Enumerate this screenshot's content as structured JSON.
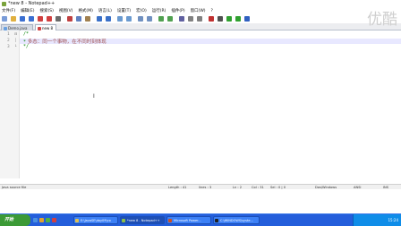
{
  "window": {
    "title": "*new  8 - Notepad++"
  },
  "menu": [
    "文件(F)",
    "编辑(E)",
    "搜索(S)",
    "视图(V)",
    "格式(M)",
    "语言(L)",
    "设置(T)",
    "宏(O)",
    "运行(R)",
    "插件(P)",
    "窗口(W)",
    "?"
  ],
  "toolbar": {
    "icons": [
      "new-file-icon",
      "open-file-icon",
      "save-icon",
      "save-all-icon",
      "close-icon",
      "close-all-icon",
      "print-icon",
      "cut-icon",
      "copy-icon",
      "paste-icon",
      "undo-icon",
      "redo-icon",
      "find-icon",
      "replace-icon",
      "zoom-in-icon",
      "zoom-out-icon",
      "sync-vertical-icon",
      "sync-horizontal-icon",
      "word-wrap-icon",
      "show-all-chars-icon",
      "indent-guide-icon",
      "macro-record-icon",
      "macro-stop-icon",
      "macro-play-icon",
      "macro-run-multiple-icon",
      "macro-save-icon"
    ],
    "colors": [
      "#7a9cd8",
      "#e0b040",
      "#3b6fd1",
      "#3b6fd1",
      "#d04040",
      "#d04040",
      "#6a6a6a",
      "#c04040",
      "#6080c0",
      "#a08050",
      "#3a70c8",
      "#3a70c8",
      "#6a9ad0",
      "#6a9ad0",
      "#7090c0",
      "#7090c0",
      "#50a050",
      "#50a050",
      "#6060a0",
      "#808080",
      "#808080",
      "#c03030",
      "#505050",
      "#30a030",
      "#30a030",
      "#3060c0"
    ]
  },
  "tabs": [
    {
      "label": "Demo.java",
      "active": false,
      "icon_color": "#6aa0e0"
    },
    {
      "label": "new 8",
      "active": true,
      "icon_color": "#d04040"
    }
  ],
  "editor": {
    "line_numbers": [
      "1",
      "2",
      "3"
    ],
    "lines": [
      {
        "code": "/*"
      },
      {
        "code": "*",
        "text": " 多态：同一个事物，在不同时刻体现"
      },
      {
        "code": "*/"
      }
    ],
    "cursor": "I",
    "watermark": "优酷"
  },
  "status": {
    "file_type": "Java source file",
    "length": "Length : 41",
    "lines": "lines : 3",
    "ln": "Ln : 2",
    "col": "Col : 31",
    "sel": "Sel : 0 | 0",
    "eol": "Dos\\Windows",
    "encoding": "ANSI",
    "mode": "INS"
  },
  "taskbar": {
    "start_label": "开始",
    "buttons": [
      {
        "label": "E:\\JavaSE\\day09\\co",
        "icon_color": "#e0c050"
      },
      {
        "label": "*new  8 - Notepad++",
        "icon_color": "#8cbf4a"
      },
      {
        "label": "Microsoft Power...",
        "icon_color": "#d05020"
      },
      {
        "label": "C:\\WINDOWS\\syste...",
        "icon_color": "#202020"
      }
    ],
    "quick_launch_colors": [
      "#4a90e0",
      "#e0a030",
      "#50b040",
      "#d04040"
    ],
    "clock": "15:24"
  }
}
